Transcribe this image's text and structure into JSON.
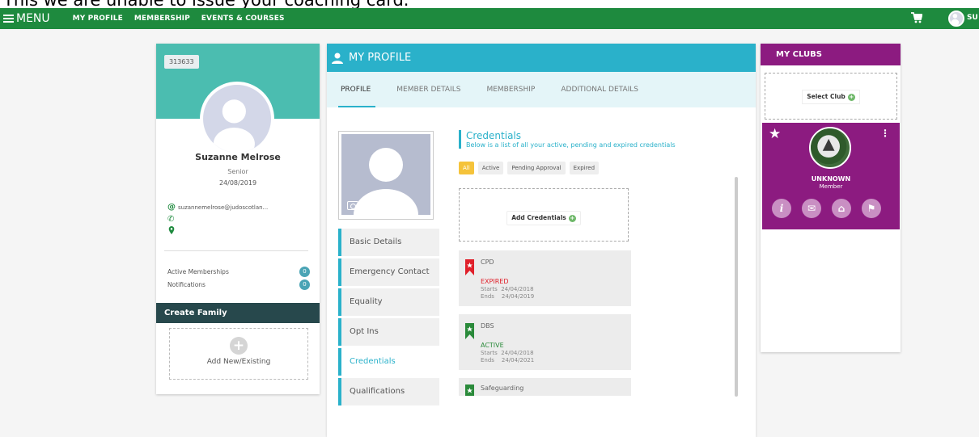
{
  "notice": "This we are unable to issue your coaching card.",
  "nav": {
    "menu_label": "MENU",
    "links": [
      "MY PROFILE",
      "MEMBERSHIP",
      "EVENTS & COURSES"
    ],
    "user_initials": "SU"
  },
  "profile_card": {
    "member_id": "313633",
    "name": "Suzanne Melrose",
    "level": "Senior",
    "date": "24/08/2019",
    "email": "suzannemelrose@judoscotlan...",
    "active_memberships_label": "Active Memberships",
    "active_memberships_count": "0",
    "notifications_label": "Notifications",
    "notifications_count": "0",
    "create_family_label": "Create Family",
    "add_new_label": "Add New/Existing"
  },
  "main": {
    "title": "MY PROFILE",
    "tabs": [
      "PROFILE",
      "MEMBER DETAILS",
      "MEMBERSHIP",
      "ADDITIONAL DETAILS"
    ],
    "side_menu": [
      "Basic Details",
      "Emergency Contact",
      "Equality",
      "Opt Ins",
      "Credentials",
      "Qualifications"
    ],
    "credentials": {
      "title": "Credentials",
      "subtitle": "Below is a list of all your active, pending and expired credentials",
      "filters": [
        "All",
        "Active",
        "Pending Approval",
        "Expired"
      ],
      "add_label": "Add Credentials",
      "items": [
        {
          "name": "CPD",
          "status": "EXPIRED",
          "starts_label": "Starts",
          "starts": "24/04/2018",
          "ends_label": "Ends",
          "ends": "24/04/2019",
          "color": "#e0202a"
        },
        {
          "name": "DBS",
          "status": "ACTIVE",
          "starts_label": "Starts",
          "starts": "24/04/2018",
          "ends_label": "Ends",
          "ends": "24/04/2021",
          "color": "#2a8a3a"
        },
        {
          "name": "Safeguarding",
          "color": "#2a8a3a"
        }
      ]
    }
  },
  "clubs": {
    "title": "MY CLUBS",
    "select_label": "Select Club",
    "club_name": "UNKNOWN",
    "club_role": "Member"
  },
  "colors": {
    "nav": "#1e8a3e",
    "teal": "#4bbdb0",
    "cyan": "#2ab1ca",
    "purple": "#8c1b80",
    "family": "#27484c",
    "expired": "#e0202a",
    "active": "#2a8a3a"
  }
}
